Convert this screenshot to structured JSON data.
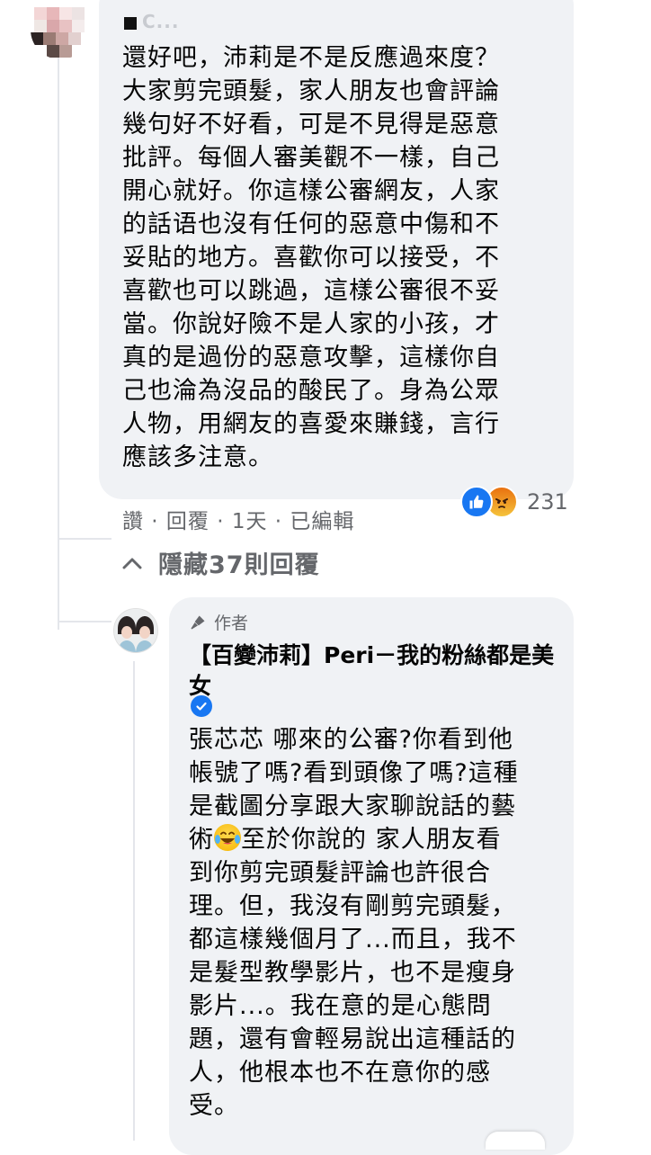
{
  "comment": {
    "author_name": "C...",
    "text": "還好吧，沛莉是不是反應過來度？\n大家剪完頭髮，家人朋友也會評論\n幾句好不好看，可是不見得是惡意\n批評。每個人審美觀不一樣，自己\n開心就好。你這樣公審網友，人家\n的話语也沒有任何的惡意中傷和不\n妥貼的地方。喜歡你可以接受，不\n喜歡也可以跳過，這樣公審很不妥\n當。你說好險不是人家的小孩，才\n真的是過份的惡意攻擊，這樣你自\n己也淪為沒品的酸民了。身為公眾\n人物，用網友的喜愛來賺錢，言行\n應該多注意。",
    "actions": "讚 · 回覆 · 1天 · 已編輯",
    "reaction_count": "231",
    "reactions": [
      "like-icon",
      "angry-icon"
    ]
  },
  "hide_replies": "隱藏37則回覆",
  "reply": {
    "badge": "作者",
    "page_name": "【百變沛莉】Peri－我的粉絲都是美女",
    "text_part1": "張芯芯 哪來的公審?你看到他\n帳號了嗎?看到頭像了嗎?這種\n是截圖分享跟大家聊說話的藝\n術",
    "text_part2": "至於你說的 家人朋友看\n到你剪完頭髮評論也許很合\n理。但，我沒有剛剪完頭髮，\n都這樣幾個月了...而且，我不\n是髮型教學影片，也不是瘦身\n影片...。我在意的是心態問\n題，還有會輕易說出這種話的\n人，他根本也不在意你的感\n受。",
    "emoji": "laughing-tears-emoji"
  },
  "colors": {
    "bubble": "#f0f2f5",
    "meta_text": "#65676b",
    "like_blue": "#1877f2",
    "thread_line": "#e4e6eb"
  }
}
